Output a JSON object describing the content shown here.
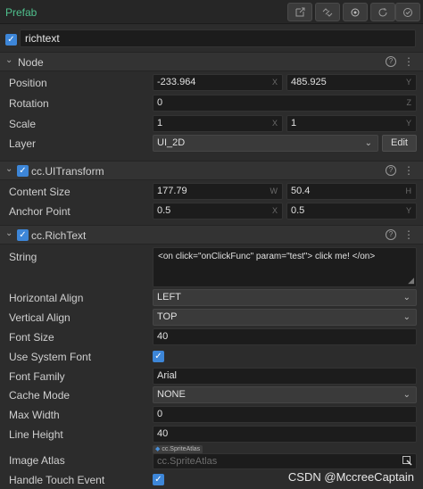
{
  "topbar": {
    "prefab_label": "Prefab",
    "icons": [
      "export-icon",
      "unlink-icon",
      "locate-icon",
      "revert-icon",
      "apply-icon"
    ]
  },
  "node_name": {
    "checked": true,
    "value": "richtext"
  },
  "node_section": {
    "title": "Node",
    "position": {
      "label": "Position",
      "x": "-233.964",
      "y": "485.925"
    },
    "rotation": {
      "label": "Rotation",
      "z": "0"
    },
    "scale": {
      "label": "Scale",
      "x": "1",
      "y": "1"
    },
    "layer": {
      "label": "Layer",
      "value": "UI_2D",
      "edit_label": "Edit"
    }
  },
  "uitransform": {
    "title": "cc.UITransform",
    "content_size": {
      "label": "Content Size",
      "w": "177.79",
      "h": "50.4"
    },
    "anchor_point": {
      "label": "Anchor Point",
      "x": "0.5",
      "y": "0.5"
    }
  },
  "richtext": {
    "title": "cc.RichText",
    "string": {
      "label": "String",
      "value": "<on click=\"onClickFunc\" param=\"test\"> click me! </on>"
    },
    "horizontal_align": {
      "label": "Horizontal Align",
      "value": "LEFT"
    },
    "vertical_align": {
      "label": "Vertical Align",
      "value": "TOP"
    },
    "font_size": {
      "label": "Font Size",
      "value": "40"
    },
    "use_system_font": {
      "label": "Use System Font",
      "checked": true
    },
    "font_family": {
      "label": "Font Family",
      "value": "Arial"
    },
    "cache_mode": {
      "label": "Cache Mode",
      "value": "NONE"
    },
    "max_width": {
      "label": "Max Width",
      "value": "0"
    },
    "line_height": {
      "label": "Line Height",
      "value": "40"
    },
    "image_atlas": {
      "label": "Image Atlas",
      "tag": "cc.SpriteAtlas",
      "placeholder": "cc.SpriteAtlas"
    },
    "handle_touch_event": {
      "label": "Handle Touch Event",
      "checked": true
    }
  },
  "axis_letters": {
    "x": "X",
    "y": "Y",
    "z": "Z",
    "w": "W",
    "h": "H"
  },
  "glyphs": {
    "check": "✓",
    "chevron": "⌄",
    "caret": "⌄",
    "help": "?",
    "kebab": "⋮"
  },
  "watermark": "CSDN @MccreeCaptain"
}
